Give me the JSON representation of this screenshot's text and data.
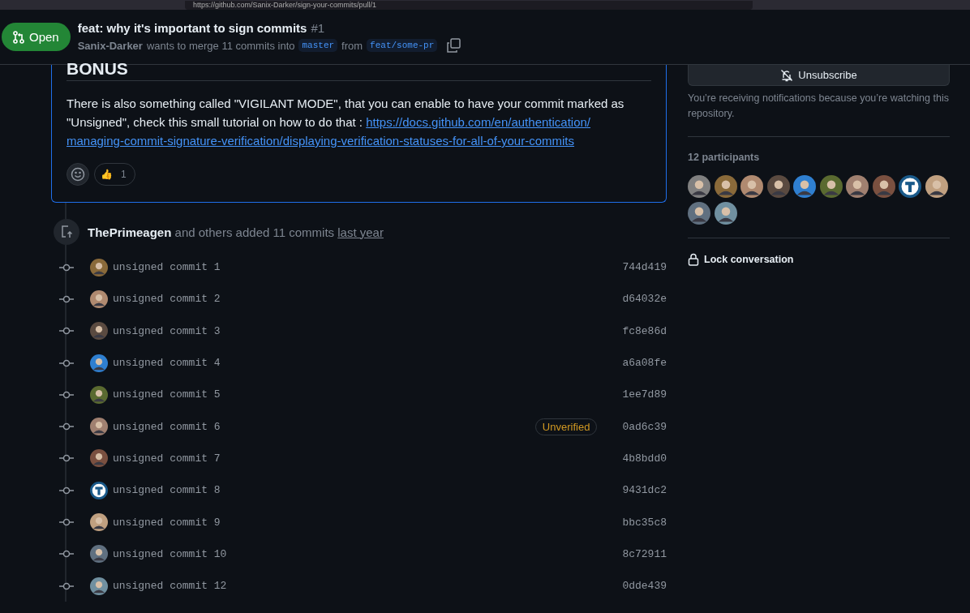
{
  "browser": {
    "url": "https://github.com/Sanix-Darker/sign-your-commits/pull/1"
  },
  "header": {
    "state": "Open",
    "title": "feat: why it's important to sign commits",
    "number": "#1",
    "author": "Sanix-Darker",
    "summary": "wants to merge 11 commits into",
    "base": "master",
    "joiner": "from",
    "head": "feat/some-pr"
  },
  "comment": {
    "heading": "BONUS",
    "body": "There is also something called \"VIGILANT MODE\", that you can enable to have your commit marked as \"Unsigned\", check this small tutorial on how to do that : ",
    "link_lines": [
      "https://docs.github.com/en/authentication/",
      "managing-commit-signature-verification/displaying-verification-statuses-for-all-of-your-commits"
    ],
    "reactions": [
      {
        "emoji": "👍",
        "count": "1"
      }
    ]
  },
  "event": {
    "actor": "ThePrimeagen",
    "text": "and others added 11 commits",
    "time": "last year"
  },
  "commits": [
    {
      "message": "unsigned commit 1",
      "sha": "744d419",
      "kind": "photo",
      "color": "#8a6a3a"
    },
    {
      "message": "unsigned commit 2",
      "sha": "d64032e",
      "kind": "photo",
      "color": "#b08a70"
    },
    {
      "message": "unsigned commit 3",
      "sha": "fc8e86d",
      "kind": "photo",
      "color": "#5a4a40"
    },
    {
      "message": "unsigned commit 4",
      "sha": "a6a08fe",
      "kind": "photo",
      "color": "#2f7fd0"
    },
    {
      "message": "unsigned commit 5",
      "sha": "1ee7d89",
      "kind": "photo",
      "color": "#5a6a30"
    },
    {
      "message": "unsigned commit 6",
      "sha": "0ad6c39",
      "kind": "photo",
      "color": "#a08070",
      "badge": "Unverified"
    },
    {
      "message": "unsigned commit 7",
      "sha": "4b8bdd0",
      "kind": "photo",
      "color": "#7a5040"
    },
    {
      "message": "unsigned commit 8",
      "sha": "9431dc2",
      "kind": "identicon",
      "color": "#1a5a8a"
    },
    {
      "message": "unsigned commit 9",
      "sha": "bbc35c8",
      "kind": "photo",
      "color": "#c0a080"
    },
    {
      "message": "unsigned commit 10",
      "sha": "8c72911",
      "kind": "photo",
      "color": "#607080"
    },
    {
      "message": "unsigned commit 12",
      "sha": "0dde439",
      "kind": "photo",
      "color": "#7090a0"
    }
  ],
  "sidebar": {
    "unsubscribe": "Unsubscribe",
    "notice": "You’re receiving notifications because you’re watching this repository.",
    "participants_title": "12 participants",
    "participants": [
      {
        "kind": "photo",
        "color": "#808080"
      },
      {
        "kind": "photo",
        "color": "#8a6a3a"
      },
      {
        "kind": "photo",
        "color": "#b08a70"
      },
      {
        "kind": "photo",
        "color": "#5a4a40"
      },
      {
        "kind": "photo",
        "color": "#2f7fd0"
      },
      {
        "kind": "photo",
        "color": "#5a6a30"
      },
      {
        "kind": "photo",
        "color": "#a08070"
      },
      {
        "kind": "photo",
        "color": "#7a5040"
      },
      {
        "kind": "identicon",
        "color": "#1a5a8a"
      },
      {
        "kind": "photo",
        "color": "#c0a080"
      },
      {
        "kind": "photo",
        "color": "#607080"
      },
      {
        "kind": "photo",
        "color": "#7090a0"
      }
    ],
    "lock": "Lock conversation"
  }
}
